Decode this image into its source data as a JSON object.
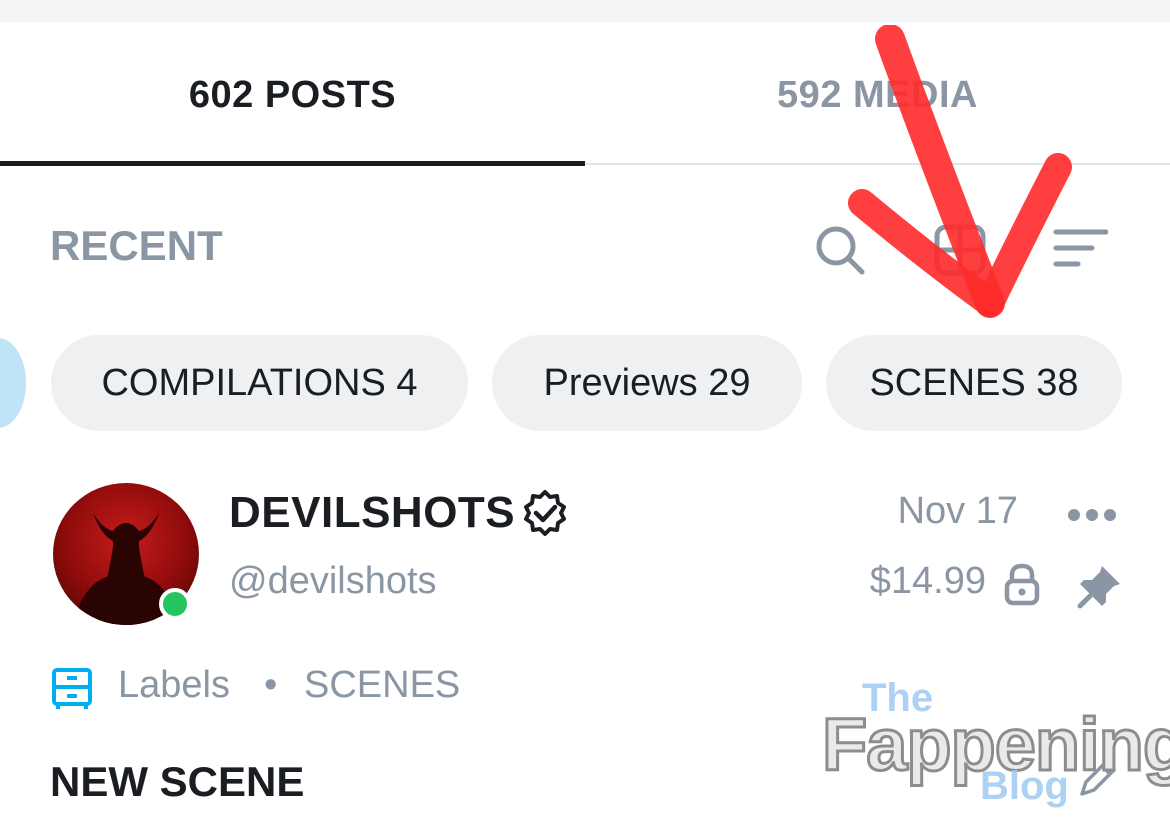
{
  "tabs": [
    {
      "label": "602 POSTS",
      "active": true
    },
    {
      "label": "592 MEDIA",
      "active": false
    }
  ],
  "section": {
    "title": "RECENT"
  },
  "toolbar": {
    "icons": [
      "search-icon",
      "grid-view-icon",
      "sort-filter-icon"
    ]
  },
  "chips": [
    {
      "label": "COMPILATIONS 4"
    },
    {
      "label": "Previews 29"
    },
    {
      "label": "SCENES 38"
    }
  ],
  "post": {
    "author_name": "DEVILSHOTS",
    "author_handle": "@devilshots",
    "date": "Nov 17",
    "price": "$14.99",
    "labels_text": "Labels",
    "labels_separator": "•",
    "label_value": "SCENES",
    "title": "NEW SCENE"
  },
  "colors": {
    "accent_blue": "#00aff0",
    "muted_text": "#8a96a3",
    "online_green": "#22c55e",
    "annotation_red": "#ff2a2a"
  },
  "watermark": {
    "line1": "The",
    "line2": "Fappening",
    "line3": "Blog"
  }
}
